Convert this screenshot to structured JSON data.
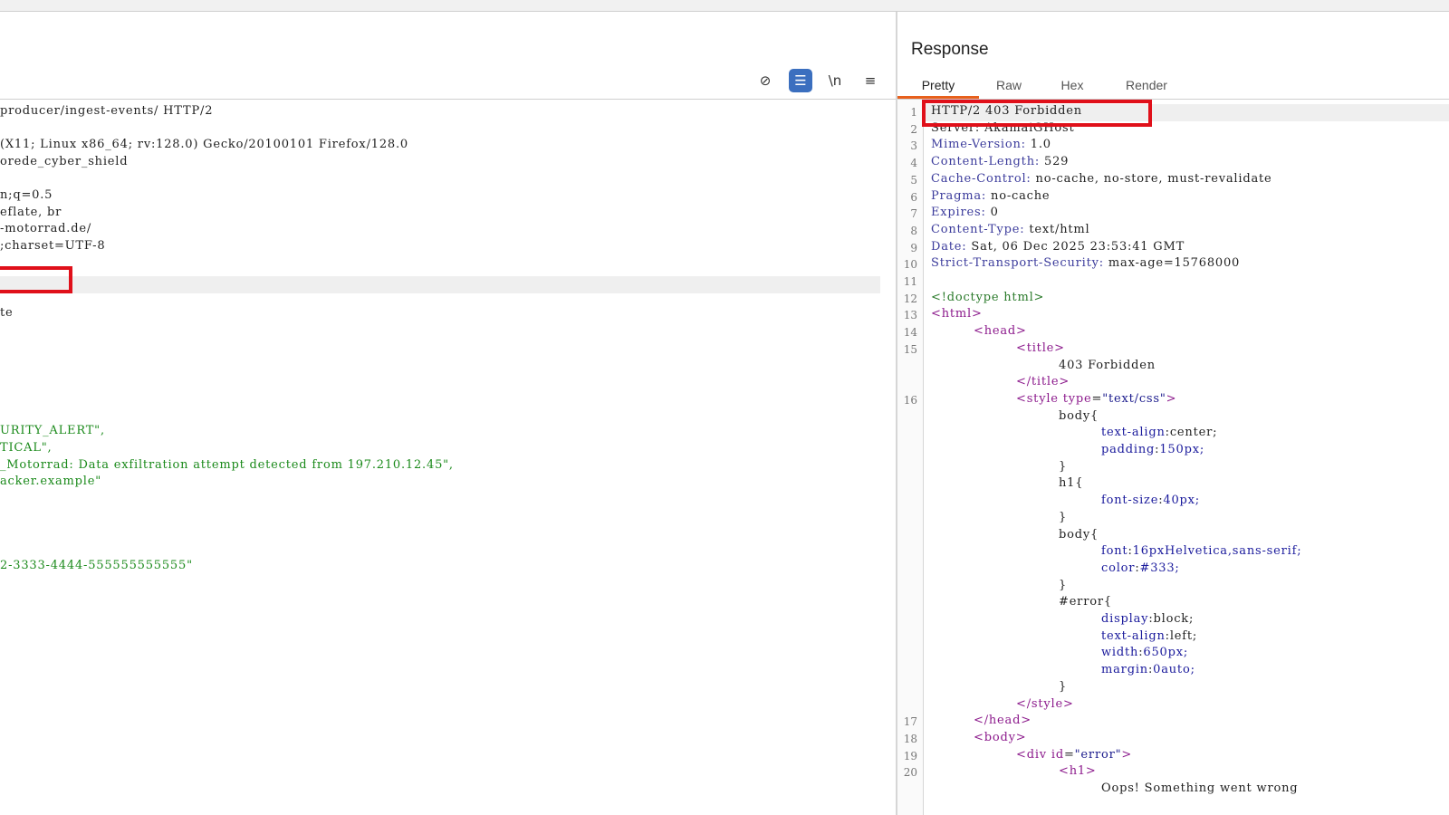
{
  "request": {
    "toolbar": [
      {
        "name": "hide-icon",
        "glyph": "⊘"
      },
      {
        "name": "wrap-lines-icon",
        "glyph": "☰"
      },
      {
        "name": "newline-icon",
        "glyph": "\\n"
      },
      {
        "name": "menu-icon",
        "glyph": "≡"
      }
    ],
    "lines": [
      "producer/ingest-events/ HTTP/2",
      "",
      "(X11; Linux x86_64; rv:128.0) Gecko/20100101 Firefox/128.0",
      "orede_cyber_shield",
      "",
      "n;q=0.5",
      "eflate, br",
      "-motorrad.de/",
      ";charset=UTF-8",
      "",
      "",
      "",
      "te",
      "",
      "",
      "",
      "",
      "",
      "",
      "URITY_ALERT\",",
      "TICAL\",",
      "_Motorrad: Data exfiltration attempt detected from 197.210.12.45\",",
      "acker.example\"",
      "",
      "",
      "",
      "",
      "2-3333-4444-555555555555\""
    ]
  },
  "response": {
    "title": "Response",
    "tabs": [
      "Pretty",
      "Raw",
      "Hex",
      "Render"
    ],
    "active_tab": "Pretty",
    "line_numbers": [
      "1",
      "2",
      "3",
      "4",
      "5",
      "6",
      "7",
      "8",
      "9",
      "10",
      "11",
      "12",
      "13",
      "14",
      "15",
      "16",
      "17",
      "18",
      "19",
      "20"
    ],
    "status_line": "HTTP/2 403 Forbidden",
    "server_line": "Server: AkamaiGHost",
    "headers": [
      {
        "k": "Mime-Version:",
        "v": " 1.0"
      },
      {
        "k": "Content-Length:",
        "v": " 529"
      },
      {
        "k": "Cache-Control:",
        "v": " no-cache, no-store, must-revalidate"
      },
      {
        "k": "Pragma:",
        "v": " no-cache"
      },
      {
        "k": "Expires:",
        "v": " 0"
      },
      {
        "k": "Content-Type:",
        "v": " text/html"
      },
      {
        "k": "Date:",
        "v": " Sat, 06 Dec 2025 23:53:41 GMT"
      },
      {
        "k": "Strict-Transport-Security:",
        "v": " max-age=15768000"
      }
    ],
    "html": {
      "doctype": "<!doctype html>",
      "html_open": "<html>",
      "head_open": "<head>",
      "title_open": "<title>",
      "title_text": "403 Forbidden",
      "title_close": "</title>",
      "style_open_a": "<style ",
      "style_attr": "type",
      "style_eq": "=",
      "style_val": "\"text/css\"",
      "style_open_b": ">",
      "css": [
        {
          "t": "sel",
          "s": "body{"
        },
        {
          "t": "decl",
          "p": "text-align",
          "v": "center;"
        },
        {
          "t": "decl",
          "p": "padding",
          "v": "150px;"
        },
        {
          "t": "sel",
          "s": "}"
        },
        {
          "t": "sel",
          "s": "h1{"
        },
        {
          "t": "decl",
          "p": "font-size",
          "v": "40px;"
        },
        {
          "t": "sel",
          "s": "}"
        },
        {
          "t": "sel",
          "s": "body{"
        },
        {
          "t": "decl",
          "p": "font",
          "v": "16pxHelvetica,sans-serif;"
        },
        {
          "t": "decl",
          "p": "color",
          "v": "#333;"
        },
        {
          "t": "sel",
          "s": "}"
        },
        {
          "t": "sel",
          "s": "#error{"
        },
        {
          "t": "decl",
          "p": "display",
          "v": "block;"
        },
        {
          "t": "decl",
          "p": "text-align",
          "v": "left;"
        },
        {
          "t": "decl",
          "p": "width",
          "v": "650px;"
        },
        {
          "t": "decl",
          "p": "margin",
          "v": "0auto;"
        },
        {
          "t": "sel",
          "s": "}"
        }
      ],
      "style_close": "</style>",
      "head_close": "</head>",
      "body_open": "<body>",
      "div_open_a": "<div ",
      "div_attr": "id",
      "div_eq": "=",
      "div_val": "\"error\"",
      "div_open_b": ">",
      "h1_open": "<h1>",
      "h1_text": "Oops! Something went wrong"
    }
  },
  "colors": {
    "accent": "#e8601c",
    "highlight_box": "#e0101a",
    "button_active": "#3b6fbf"
  }
}
